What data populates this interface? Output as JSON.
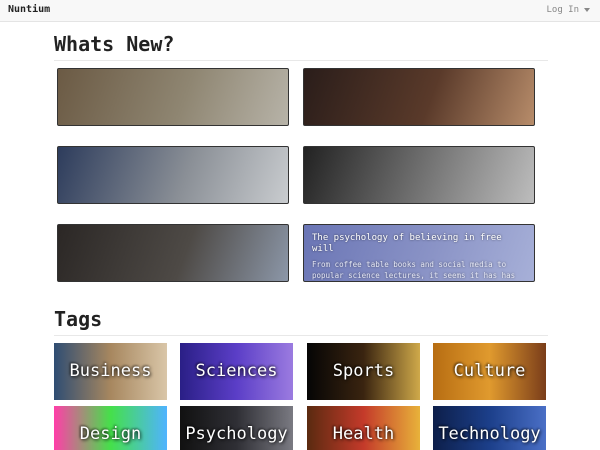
{
  "navbar": {
    "brand": "Nuntium",
    "login_label": "Log In"
  },
  "whats_new": {
    "title": "Whats New?",
    "cards": [
      {
        "image": "koala-photo",
        "colors": [
          "#6b5a44",
          "#8f8672",
          "#b7b3a8"
        ]
      },
      {
        "image": "vet-surgery-photo",
        "colors": [
          "#2a1d1a",
          "#5a3a2a",
          "#b78c6a"
        ]
      },
      {
        "image": "hospital-nurse-photo",
        "colors": [
          "#2d3c5c",
          "#8a8f96",
          "#c9cccf"
        ]
      },
      {
        "image": "protest-crowd-photo",
        "colors": [
          "#222222",
          "#777777",
          "#bdbdbd"
        ]
      },
      {
        "image": "microscope-worker-photo",
        "colors": [
          "#2b2725",
          "#4e4a46",
          "#8c97a8"
        ]
      },
      {
        "image": "blue-sky-dandelion-photo",
        "colors": [
          "#6a75b5",
          "#8a93c6",
          "#a7b0d8"
        ],
        "title": "The psychology of believing in free will",
        "description": "From coffee table books and social media to popular science lectures, it seems it has has"
      }
    ]
  },
  "tags": {
    "title": "Tags",
    "items": [
      {
        "label": "Business",
        "image": "handshake-image",
        "colors": [
          "#2f4d73",
          "#a7875f",
          "#d9c6a8"
        ]
      },
      {
        "label": "Sciences",
        "image": "chemistry-flask-image",
        "colors": [
          "#2a1f86",
          "#5b3ec7",
          "#9b7be0"
        ]
      },
      {
        "label": "Sports",
        "image": "sports-balls-image",
        "colors": [
          "#050505",
          "#3a2410",
          "#cfa94a"
        ]
      },
      {
        "label": "Culture",
        "image": "instruments-image",
        "colors": [
          "#b76d12",
          "#e09a2e",
          "#7a3d1a"
        ]
      },
      {
        "label": "Design",
        "image": "color-spectrum-image",
        "colors": [
          "#ff3ea8",
          "#45e04a",
          "#4fb3ff"
        ]
      },
      {
        "label": "Psychology",
        "image": "lightbulb-image",
        "colors": [
          "#111111",
          "#2f2f35",
          "#7a7a82"
        ]
      },
      {
        "label": "Health",
        "image": "fruits-image",
        "colors": [
          "#5a2a10",
          "#c43a2a",
          "#e8b23a"
        ]
      },
      {
        "label": "Technology",
        "image": "circuit-board-image",
        "colors": [
          "#0d1f4a",
          "#1c3f8a",
          "#4a6fc6"
        ]
      }
    ]
  }
}
